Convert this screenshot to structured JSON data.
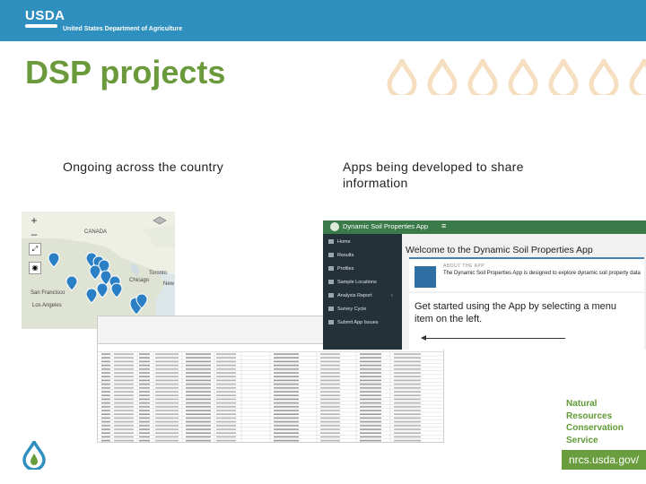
{
  "header": {
    "logo_text": "USDA",
    "agency": "United States Department of Agriculture"
  },
  "slide": {
    "title": "DSP projects",
    "left_caption": "Ongoing across the country",
    "right_caption": "Apps being developed to share information"
  },
  "map": {
    "zoom_in": "+",
    "zoom_out": "–",
    "labels": {
      "canada": "CANADA",
      "toronto": "Toronto",
      "chicago": "Chicago",
      "new_york": "New",
      "sf": "San Francisco",
      "la": "Los Angeles"
    }
  },
  "app": {
    "title": "Dynamic Soil Properties App",
    "hamburger": "≡",
    "menu": [
      {
        "label": "Home"
      },
      {
        "label": "Results"
      },
      {
        "label": "Profiles"
      },
      {
        "label": "Sample Locations"
      },
      {
        "label": "Analysis Report",
        "caret": "‹"
      },
      {
        "label": "Survey Cycle"
      },
      {
        "label": "Submit App Issues"
      }
    ],
    "welcome": "Welcome to the Dynamic Soil Properties App",
    "about_heading": "ABOUT THE APP",
    "about_text": "The Dynamic Soil Properties App is designed to explore dynamic soil property data",
    "get_started": "Get started using the App by selecting a menu item on the left."
  },
  "nrcs": {
    "name_lines": [
      "Natural",
      "Resources",
      "Conservation",
      "Service"
    ],
    "url": "nrcs.usda.gov/"
  },
  "colors": {
    "header": "#2f8fbf",
    "title_green": "#6a9a3b",
    "app_green": "#3b7a49",
    "app_sidebar": "#243138",
    "marker": "#2b7fc4"
  }
}
